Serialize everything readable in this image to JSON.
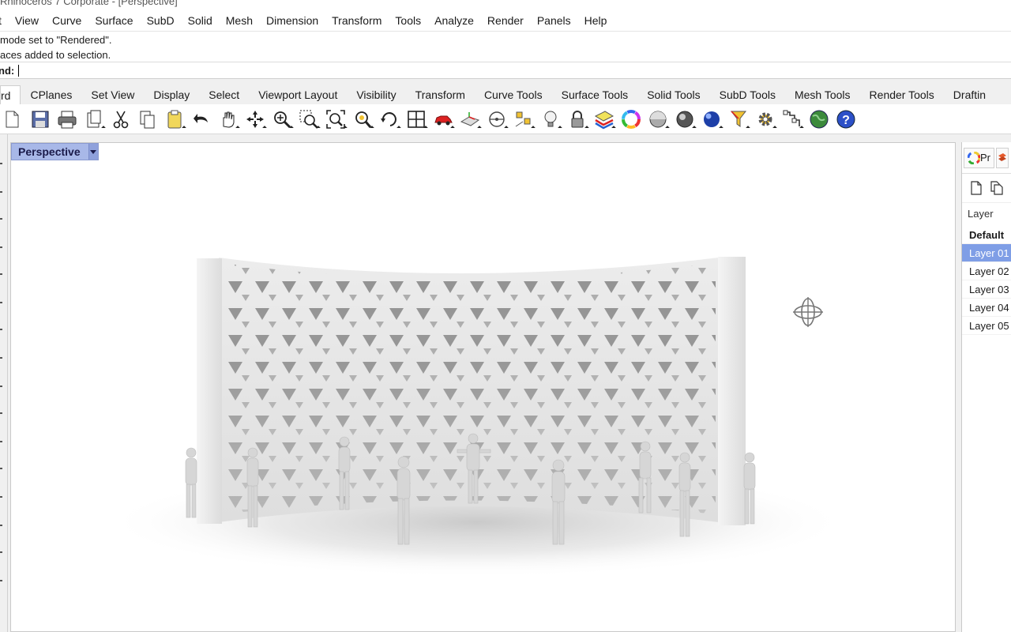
{
  "window": {
    "title": "Rhinoceros 7 Corporate - [Perspective]"
  },
  "menu": [
    "t",
    "View",
    "Curve",
    "Surface",
    "SubD",
    "Solid",
    "Mesh",
    "Dimension",
    "Transform",
    "Tools",
    "Analyze",
    "Render",
    "Panels",
    "Help"
  ],
  "history": [
    "mode set to \"Rendered\".",
    "aces added to selection."
  ],
  "command": {
    "label": "nd:",
    "value": ""
  },
  "tabs": [
    "rd",
    "CPlanes",
    "Set View",
    "Display",
    "Select",
    "Viewport Layout",
    "Visibility",
    "Transform",
    "Curve Tools",
    "Surface Tools",
    "Solid Tools",
    "SubD Tools",
    "Mesh Tools",
    "Render Tools",
    "Draftin"
  ],
  "toolbar": [
    "new-icon",
    "save-icon",
    "print-icon",
    "copy-to-clipboard-icon",
    "cut-icon",
    "copy-icon",
    "paste-icon",
    "undo-icon",
    "pan-icon",
    "rotate-view-icon",
    "zoom-icon",
    "zoom-window-icon",
    "zoom-extents-icon",
    "zoom-selected-icon",
    "rotate-icon",
    "four-viewports-icon",
    "car-icon",
    "cplane-icon",
    "dimension-icon",
    "points-icon",
    "light-bulb-icon",
    "lock-icon",
    "layer-icon",
    "color-wheel-icon",
    "shaded-sphere-icon",
    "rendered-sphere-icon",
    "material-sphere-icon",
    "selection-filter-icon",
    "options-gear-icon",
    "grasshopper-icon",
    "globe-icon",
    "help-icon"
  ],
  "viewport": {
    "name": "Perspective"
  },
  "panel": {
    "tab_label": "Pr",
    "layer_header": "Layer",
    "layers": [
      {
        "name": "Default",
        "bold": true,
        "selected": false
      },
      {
        "name": "Layer 01",
        "bold": false,
        "selected": true
      },
      {
        "name": "Layer 02",
        "bold": false,
        "selected": false
      },
      {
        "name": "Layer 03",
        "bold": false,
        "selected": false
      },
      {
        "name": "Layer 04",
        "bold": false,
        "selected": false
      },
      {
        "name": "Layer 05",
        "bold": false,
        "selected": false
      }
    ]
  },
  "colors": {
    "accent": "#7f9ee6",
    "viewport_tab": "#a8b8e8"
  }
}
